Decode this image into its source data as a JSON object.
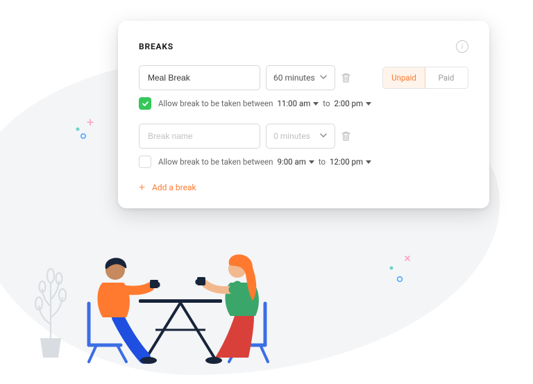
{
  "card": {
    "title": "BREAKS",
    "add_break_label": "Add a break",
    "toggle": {
      "unpaid": "Unpaid",
      "paid": "Paid"
    },
    "allow_label": "Allow break to be taken between",
    "to_label": "to"
  },
  "breaks": [
    {
      "name": "Meal Break",
      "name_placeholder": "Break name",
      "duration": "60 minutes",
      "checked": true,
      "time_from": "11:00 am",
      "time_to": "2:00 pm"
    },
    {
      "name": "",
      "name_placeholder": "Break name",
      "duration": "0 minutes",
      "checked": false,
      "time_from": "9:00 am",
      "time_to": "12:00 pm"
    }
  ]
}
